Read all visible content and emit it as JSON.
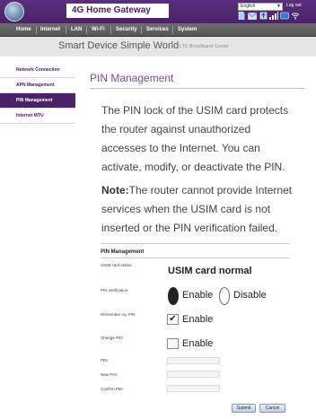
{
  "header": {
    "product_name": "4G Home Gateway",
    "language": "English",
    "logout": "Log out"
  },
  "status_icons": [
    "sim-icon",
    "mail-icon",
    "upload-icon",
    "signal-icon",
    "lte-icon",
    "wifi-icon"
  ],
  "nav": {
    "items": [
      "Home",
      "Internet",
      "LAN",
      "Wi-Fi",
      "Security",
      "Services",
      "System"
    ],
    "active": "Internet"
  },
  "banner": {
    "smart_device": "Smart Device",
    "simple_world": "Simple World",
    "tagline": "LTE Broadband Center"
  },
  "sidebar": {
    "items": [
      {
        "label": "Network Connection"
      },
      {
        "label": "APN Management"
      },
      {
        "label": "PIN Management"
      },
      {
        "label": "Internet MTU"
      }
    ],
    "active_index": 2
  },
  "main": {
    "title": "PIN Management",
    "description": "The PIN lock of the USIM card protects the router against unauthorized accesses to the Internet. You can activate, modify, or deactivate the PIN.",
    "note_label": "Note:",
    "note_text": "The router cannot provide Internet services when the USIM card is not inserted or the PIN verification failed."
  },
  "form": {
    "title": "PIN Management",
    "usim_status_label": "USIM card status:",
    "usim_status_value": "USIM card normal",
    "pin_verification_label": "PIN verification:",
    "enable_label": "Enable",
    "disable_label": "Disable",
    "pin_verification_value": "Enable",
    "remember_pin_label": "Remember my PIN:",
    "remember_pin_checked": true,
    "remember_pin_option": "Enable",
    "change_pin_label": "Change PIN:",
    "change_pin_checked": false,
    "change_pin_option": "Enable",
    "pin_label": "PIN:",
    "new_pin_label": "New PIN:",
    "confirm_pin_label": "Confirm PIN:",
    "pin_value": "",
    "new_pin_value": "",
    "confirm_pin_value": ""
  },
  "buttons": {
    "submit": "Submit",
    "cancel": "Cancel"
  }
}
